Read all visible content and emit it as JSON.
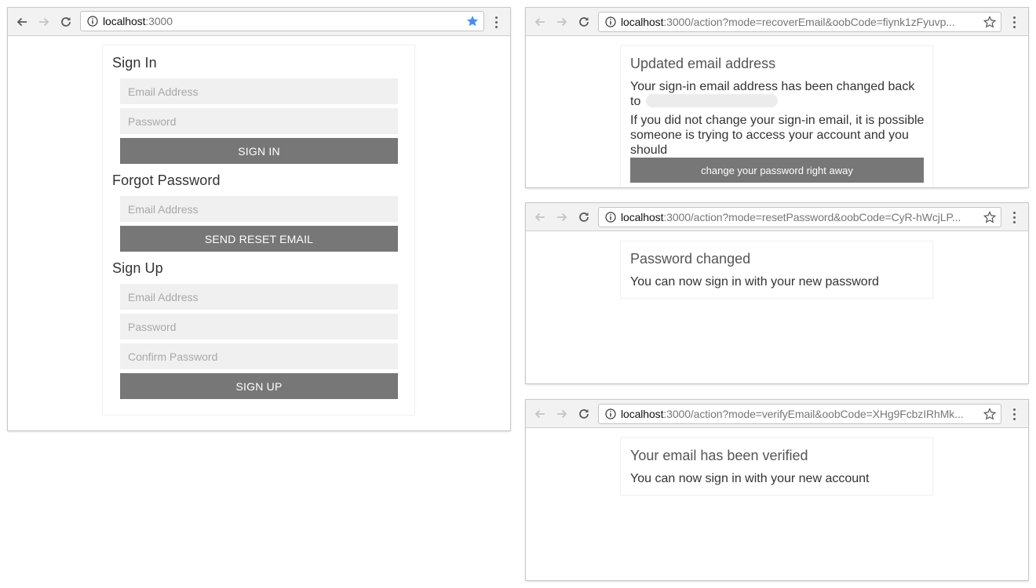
{
  "windows": {
    "main": {
      "url_host": "localhost",
      "url_rest": ":3000",
      "bookmarked": true,
      "star_color": "#4a8ef0",
      "signin": {
        "title": "Sign In",
        "email_placeholder": "Email Address",
        "password_placeholder": "Password",
        "button": "SIGN IN"
      },
      "forgot": {
        "title": "Forgot Password",
        "email_placeholder": "Email Address",
        "button": "SEND RESET EMAIL"
      },
      "signup": {
        "title": "Sign Up",
        "email_placeholder": "Email Address",
        "password_placeholder": "Password",
        "confirm_placeholder": "Confirm Password",
        "button": "SIGN UP"
      }
    },
    "recover": {
      "url_host": "localhost",
      "url_prefix": ":3000/action?",
      "url_mode": "mode=recoverEmail",
      "url_suffix": "&oobCode=fiynk1zFyuvp...",
      "title": "Updated email address",
      "body1": "Your sign-in email address has been changed back to",
      "body1_tail": "to",
      "body2": "If you did not change your sign-in email, it is possible someone is trying to access your account and you should",
      "button": "change your password right away"
    },
    "reset": {
      "url_host": "localhost",
      "url_prefix": ":3000/action?",
      "url_mode": "mode=resetPassword",
      "url_suffix": "&oobCode=CyR-hWcjLP...",
      "title": "Password changed",
      "body": "You can now sign in with your new password"
    },
    "verify": {
      "url_host": "localhost",
      "url_prefix": ":3000/action?",
      "url_mode": "mode=verifyEmail",
      "url_suffix": "&oobCode=XHg9FcbzIRhMk...",
      "title": "Your email has been verified",
      "body": "You can now sign in with your new account"
    }
  },
  "colors": {
    "highlight_underline": "#f0a020",
    "button_bg": "#777777",
    "input_bg": "#f0f0f0"
  }
}
